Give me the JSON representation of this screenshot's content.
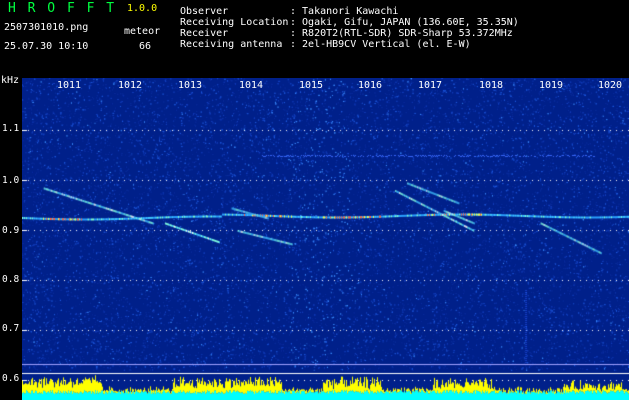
{
  "header": {
    "app_name": "H R O F F T",
    "version": "1.0.0",
    "filename": "2507301010.png",
    "datetime": "25.07.30 10:10",
    "mode_label": "meteor",
    "mode_count": "66",
    "info": [
      {
        "label": "Observer",
        "value": ": Takanori Kawachi"
      },
      {
        "label": "Receiving Location",
        "value": ": Ogaki, Gifu, JAPAN (136.60E, 35.35N)"
      },
      {
        "label": "Receiver",
        "value": ": R820T2(RTL-SDR) SDR-Sharp 53.372MHz"
      },
      {
        "label": "Receiving antenna",
        "value": ": 2el-HB9CV Vertical (el. E-W)"
      }
    ]
  },
  "colors": {
    "title": "#00ff40",
    "version": "#ffff00",
    "text": "#ffffff",
    "background": "#000000",
    "spectrogram_base": "#00208a",
    "bar_yellow": "#ffff00",
    "bar_cyan": "#00ffff"
  },
  "chart_data": {
    "type": "heatmap",
    "ylabel": "kHz",
    "y_ticks": [
      "1.1",
      "1.0",
      "0.9",
      "0.8",
      "0.7",
      "0.6"
    ],
    "x_ticks": [
      "1011",
      "1012",
      "1013",
      "1014",
      "1015",
      "1016",
      "1017",
      "1018",
      "1019",
      "1020"
    ],
    "carrier_khz": 0.93,
    "meteor_traces": [
      {
        "x0": 1010.6,
        "y0": 0.985,
        "x1": 1012.4,
        "y1": 0.915
      },
      {
        "x0": 1012.6,
        "y0": 0.915,
        "x1": 1013.5,
        "y1": 0.877
      },
      {
        "x0": 1013.8,
        "y0": 0.9,
        "x1": 1014.7,
        "y1": 0.873
      },
      {
        "x0": 1013.7,
        "y0": 0.945,
        "x1": 1014.3,
        "y1": 0.925
      },
      {
        "x0": 1016.6,
        "y0": 0.995,
        "x1": 1017.45,
        "y1": 0.955
      },
      {
        "x0": 1016.4,
        "y0": 0.98,
        "x1": 1017.7,
        "y1": 0.9
      },
      {
        "x0": 1017.2,
        "y0": 0.94,
        "x1": 1017.7,
        "y1": 0.915
      },
      {
        "x0": 1018.8,
        "y0": 0.915,
        "x1": 1019.8,
        "y1": 0.855
      }
    ]
  }
}
